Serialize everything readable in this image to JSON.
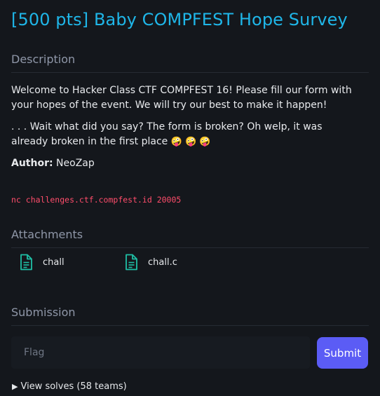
{
  "challenge": {
    "title": "[500 pts] Baby COMPFEST Hope Survey"
  },
  "description": {
    "heading": "Description",
    "paragraph1": "Welcome to Hacker Class CTF COMPFEST 16! Please fill our form with your hopes of the event. We will try our best to make it happen!",
    "paragraph2": ". . . Wait what did you say? The form is broken? Oh welp, it was already broken in the first place",
    "emojis": "🤪 🤪 🤪",
    "author_label": "Author:",
    "author_name": "NeoZap",
    "command": "nc challenges.ctf.compfest.id 20005"
  },
  "attachments": {
    "heading": "Attachments",
    "files": [
      {
        "name": "chall",
        "icon": "file-icon"
      },
      {
        "name": "chall.c",
        "icon": "file-icon"
      }
    ]
  },
  "submission": {
    "heading": "Submission",
    "flag_placeholder": "Flag",
    "submit_label": "Submit"
  },
  "solves": {
    "label": "View solves (58 teams)"
  },
  "colors": {
    "background": "#14171c",
    "title": "#1fb6e8",
    "accent_button": "#5b5cf5",
    "code": "#ff4d6b",
    "file_icon": "#1fbfa5"
  }
}
